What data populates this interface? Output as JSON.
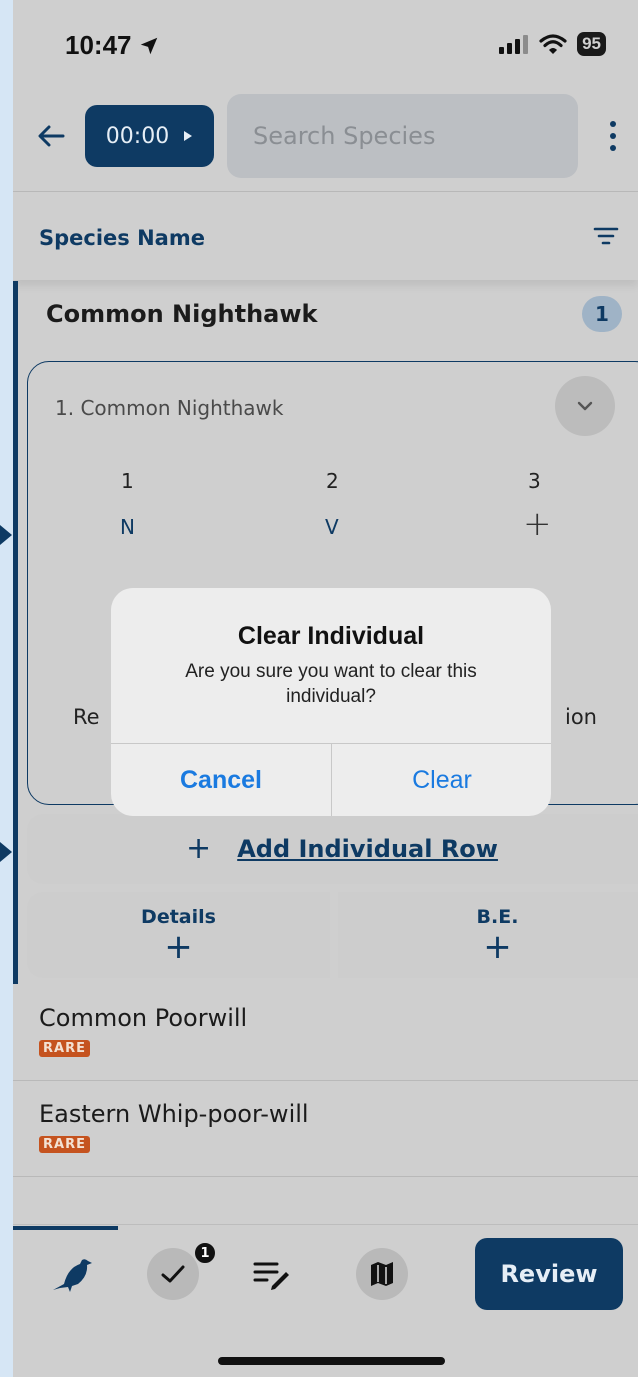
{
  "status_bar": {
    "time": "10:47",
    "battery": "95"
  },
  "header": {
    "timer_label": "00:00",
    "search_placeholder": "Search Species"
  },
  "list_header": {
    "label": "Species Name"
  },
  "expanded_species": {
    "name": "Common Nighthawk",
    "count": "1",
    "individual": {
      "title": "1. Common Nighthawk",
      "columns": [
        {
          "number": "1",
          "value": "N"
        },
        {
          "number": "2",
          "value": "V"
        },
        {
          "number": "3",
          "value": "+"
        }
      ],
      "partial_left": "Re",
      "partial_right": "ion"
    },
    "add_row_label": "Add Individual Row",
    "details_label": "Details",
    "be_label": "B.E."
  },
  "species_list": [
    {
      "name": "Common Poorwill",
      "badge": "RARE"
    },
    {
      "name": "Eastern Whip-poor-will",
      "badge": "RARE"
    }
  ],
  "dialog": {
    "title": "Clear Individual",
    "message": "Are you sure you want to clear this individual?",
    "cancel_label": "Cancel",
    "confirm_label": "Clear",
    "button_color": "#1a7ae0"
  },
  "bottom_nav": {
    "checklist_badge": "1",
    "review_label": "Review",
    "icons": [
      "bird-icon",
      "checkmark-icon",
      "notes-edit-icon",
      "map-icon"
    ]
  },
  "colors": {
    "primary": "#0e3a63",
    "rare_badge": "#c5531f",
    "overlay_background": "#cfcfcf"
  }
}
